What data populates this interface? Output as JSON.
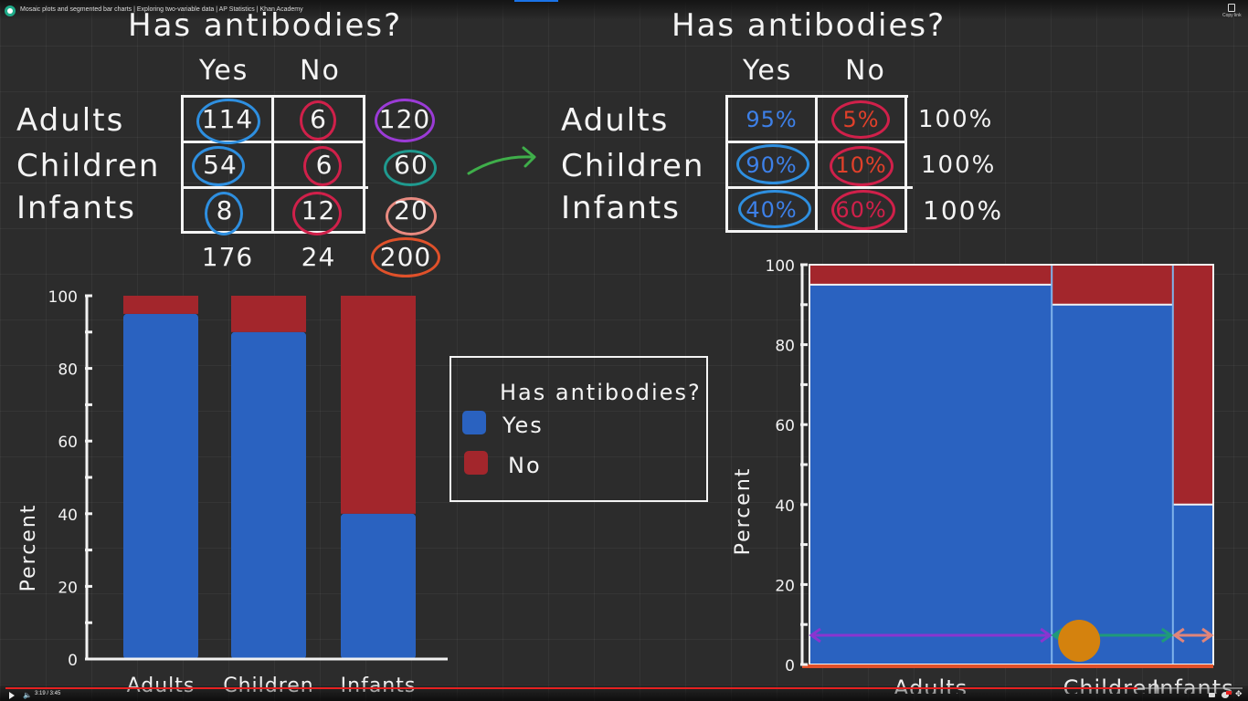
{
  "player": {
    "video_title": "Mosaic plots and segmented bar charts | Exploring two-variable data | AP Statistics | Khan Academy",
    "copy_link_label": "Copy link",
    "time_display": "3:19 / 3:45",
    "progress_fraction": 0.915,
    "icons": [
      "khan-academy-logo",
      "copy-link-icon",
      "play-icon",
      "volume-icon",
      "captions-icon",
      "settings-icon",
      "fullscreen-exit-icon"
    ]
  },
  "colors": {
    "background": "#2c2c2c",
    "yes_blue": "#2a62c0",
    "no_red": "#a3262c",
    "circle_blue": "#2e8fe0",
    "circle_red": "#d0204a",
    "circle_purple": "#9b3bd6",
    "circle_teal": "#1f9a8f",
    "circle_pink": "#e88a80",
    "circle_orange": "#e0512a",
    "arrow_green": "#3fae4a",
    "marker_orange": "#d4820e",
    "arrow_purple": "#8a35d0",
    "arrow_teal": "#1f9a7a",
    "arrow_pink": "#e0857a"
  },
  "counts_table": {
    "title": "Has antibodies?",
    "columns": [
      "Yes",
      "No"
    ],
    "rows": [
      {
        "label": "Adults",
        "yes": "114",
        "no": "6",
        "total": "120"
      },
      {
        "label": "Children",
        "yes": "54",
        "no": "6",
        "total": "60"
      },
      {
        "label": "Infants",
        "yes": "8",
        "no": "12",
        "total": "20"
      }
    ],
    "column_totals": {
      "yes": "176",
      "no": "24",
      "grand": "200"
    }
  },
  "percent_table": {
    "title": "Has antibodies?",
    "columns": [
      "Yes",
      "No"
    ],
    "rows": [
      {
        "label": "Adults",
        "yes": "95%",
        "no": "5%",
        "total": "100%"
      },
      {
        "label": "Children",
        "yes": "90%",
        "no": "10%",
        "total": "100%"
      },
      {
        "label": "Infants",
        "yes": "40%",
        "no": "60%",
        "total": "100%"
      }
    ]
  },
  "legend": {
    "title": "Has antibodies?",
    "items": [
      {
        "label": "Yes",
        "color": "#2a62c0"
      },
      {
        "label": "No",
        "color": "#a3262c"
      }
    ]
  },
  "chart_data": [
    {
      "type": "bar",
      "subtype": "segmented (100% stacked)",
      "title": "",
      "xlabel": "",
      "ylabel": "Percent",
      "categories": [
        "Adults",
        "Children",
        "Infants"
      ],
      "series": [
        {
          "name": "Yes",
          "values": [
            95,
            90,
            40
          ]
        },
        {
          "name": "No",
          "values": [
            5,
            10,
            60
          ]
        }
      ],
      "ylim": [
        0,
        100
      ],
      "yticks": [
        0,
        20,
        40,
        60,
        80,
        100
      ],
      "ytick_labels": [
        "0",
        "20",
        "40",
        "60",
        "80",
        "100"
      ],
      "minor_tick_step": 10,
      "legend": "right",
      "grid": false
    },
    {
      "type": "bar",
      "subtype": "mosaic",
      "title": "",
      "xlabel": "",
      "ylabel": "Percent",
      "categories": [
        "Adults",
        "Children",
        "Infants"
      ],
      "widths": [
        120,
        60,
        20
      ],
      "series": [
        {
          "name": "Yes",
          "values": [
            95,
            90,
            40
          ]
        },
        {
          "name": "No",
          "values": [
            5,
            10,
            60
          ]
        }
      ],
      "ylim": [
        0,
        100
      ],
      "yticks": [
        0,
        20,
        40,
        60,
        80,
        100
      ],
      "ytick_labels": [
        "0",
        "20",
        "40",
        "60",
        "80",
        "100"
      ],
      "minor_tick_step": 10,
      "grid": false
    }
  ]
}
